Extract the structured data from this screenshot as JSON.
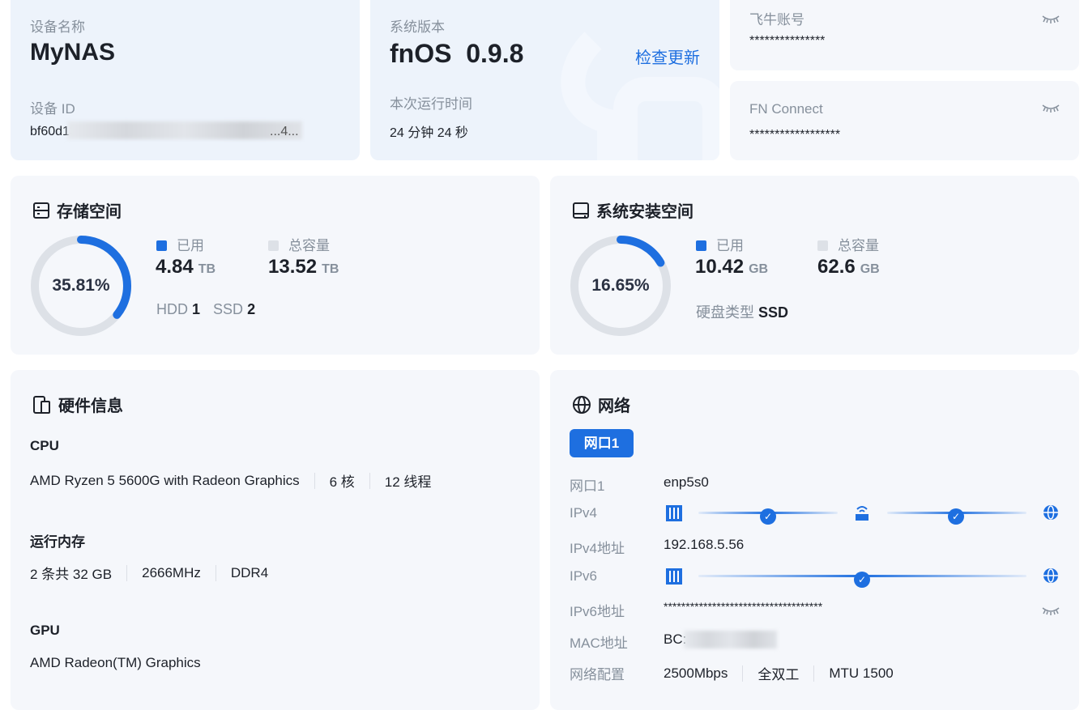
{
  "device": {
    "name_label": "设备名称",
    "name": "MyNAS",
    "id_label": "设备 ID",
    "id": "bf60d1391",
    "id_tail": "...4..."
  },
  "system": {
    "version_label": "系统版本",
    "version": "fnOS  0.9.8",
    "check_update": "检查更新",
    "uptime_label": "本次运行时间",
    "uptime": "24 分钟 24 秒"
  },
  "account": {
    "label": "飞牛账号",
    "value": "***************"
  },
  "fnconnect": {
    "label": "FN Connect",
    "value": "******************"
  },
  "storage": {
    "title": "存储空间",
    "percent": "35.81%",
    "percent_value": 35.81,
    "used_label": "已用",
    "used": "4.84",
    "used_unit": "TB",
    "total_label": "总容量",
    "total": "13.52",
    "total_unit": "TB",
    "hdd_label": "HDD",
    "hdd": "1",
    "ssd_label": "SSD",
    "ssd": "2"
  },
  "sysdisk": {
    "title": "系统安装空间",
    "percent": "16.65%",
    "percent_value": 16.65,
    "used_label": "已用",
    "used": "10.42",
    "used_unit": "GB",
    "total_label": "总容量",
    "total": "62.6",
    "total_unit": "GB",
    "type_label": "硬盘类型",
    "type": "SSD"
  },
  "hardware": {
    "title": "硬件信息",
    "cpu_label": "CPU",
    "cpu": "AMD Ryzen 5 5600G with Radeon Graphics",
    "cores": "6 核",
    "threads": "12 线程",
    "mem_label": "运行内存",
    "mem": "2 条共 32 GB",
    "mem_speed": "2666MHz",
    "mem_type": "DDR4",
    "gpu_label": "GPU",
    "gpu": "AMD Radeon(TM) Graphics"
  },
  "network": {
    "title": "网络",
    "tab": "网口1",
    "rows": {
      "port_label": "网口1",
      "port": "enp5s0",
      "ipv4_label": "IPv4",
      "ipv4addr_label": "IPv4地址",
      "ipv4addr": "192.168.5.56",
      "ipv6_label": "IPv6",
      "ipv6addr_label": "IPv6地址",
      "ipv6addr": "************************************",
      "mac_label": "MAC地址",
      "mac": "BC:",
      "config_label": "网络配置",
      "speed": "2500Mbps",
      "duplex": "全双工",
      "mtu": "MTU 1500"
    }
  },
  "colors": {
    "accent": "#1e6fe0",
    "ring": "#dde1e7"
  }
}
